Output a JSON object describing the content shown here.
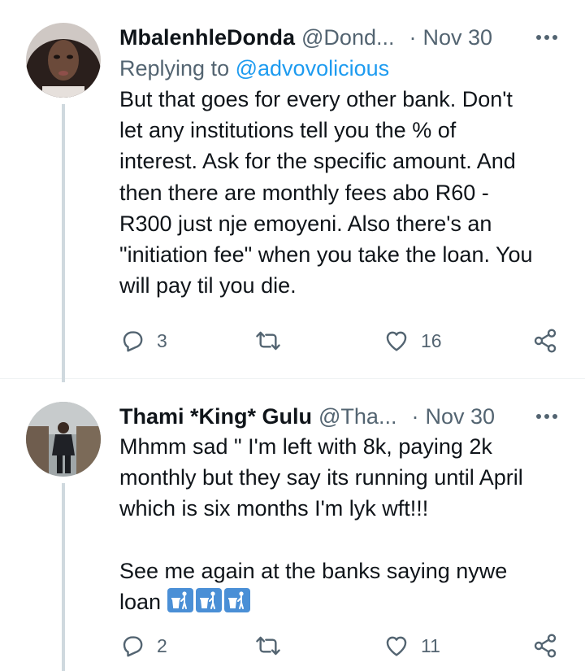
{
  "tweets": [
    {
      "name": "MbalenhleDonda",
      "handle": "@Dond...",
      "separator": "·",
      "date": "Nov 30",
      "replying_prefix": "Replying to",
      "replying_mention": "@advovolicious",
      "text": "But that goes for every other bank. Don't\nlet any institutions tell you the % of\ninterest. Ask for the specific amount. And\nthen there are monthly fees abo R60 -\nR300 just nje emoyeni. Also there's an\n\"initiation fee\" when you take the loan. You\nwill pay til you die.",
      "replies": "3",
      "retweets": "",
      "likes": "16"
    },
    {
      "name": "Thami *King* Gulu",
      "handle": "@Tha...",
      "separator": "·",
      "date": "Nov 30",
      "text": "Mhmm sad \" I'm left with 8k, paying 2k\nmonthly but they say its running until April\nwhich is six months I'm lyk wft!!!\n\nSee me again at the banks saying nywe\nloan",
      "emoji": [
        "put-litter-in-its-place-icon",
        "put-litter-in-its-place-icon",
        "put-litter-in-its-place-icon"
      ],
      "replies": "2",
      "retweets": "",
      "likes": "11"
    }
  ],
  "colors": {
    "text": "#0f1419",
    "secondary": "#536471",
    "link": "#1d9bf0",
    "thread_line": "#cfd9de",
    "emoji_bg": "#4a8fd6"
  }
}
